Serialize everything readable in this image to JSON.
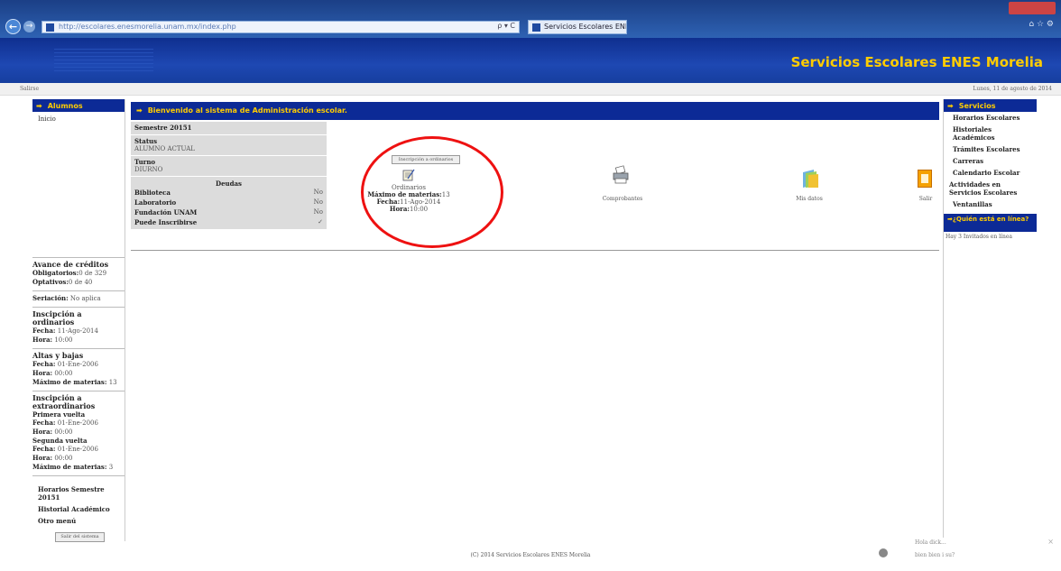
{
  "browser": {
    "url": "http://escolares.enesmorelia.unam.mx/index.php",
    "address_tools": "ρ ▾ C",
    "tab_title": "Servicios Escolares ENES M... ×",
    "back": "←",
    "forward": "→",
    "window_icons": "⌂ ☆ ⚙"
  },
  "header": {
    "title": "Servicios Escolares ENES Morelia"
  },
  "topbar": {
    "home": "Salirse",
    "date": "Lunes, 11 de agosto de 2014"
  },
  "left": {
    "heading": "Alumnos",
    "inicio": "Inicio",
    "avance": {
      "title": "Avance de créditos",
      "obligatorios_label": "Obligatorios:",
      "obligatorios_value": "0 de 329",
      "optativos_label": "Optativos:",
      "optativos_value": "0 de 40"
    },
    "seriacion": {
      "label": "Seriación:",
      "value": "No aplica"
    },
    "insc_ord": {
      "title": "Inscipción a ordinarios",
      "fecha_label": "Fecha:",
      "fecha_value": "11-Ago-2014",
      "hora_label": "Hora:",
      "hora_value": "10:00"
    },
    "altas": {
      "title": "Altas y bajas",
      "fecha_label": "Fecha:",
      "fecha_value": "01-Ene-2006",
      "hora_label": "Hora:",
      "hora_value": "00:00",
      "max_label": "Máximo de materias:",
      "max_value": "13"
    },
    "extra": {
      "title": "Inscipción a extraordinarios",
      "primera": "Primera vuelta",
      "fecha1_label": "Fecha:",
      "fecha1_value": "01-Ene-2006",
      "hora1_label": "Hora:",
      "hora1_value": "00:00",
      "segunda": "Segunda vuelta",
      "fecha2_label": "Fecha:",
      "fecha2_value": "01-Ene-2006",
      "hora2_label": "Hora:",
      "hora2_value": "00:00",
      "max_label": "Máximo de materias:",
      "max_value": "3"
    },
    "horarios": "Horarios Semestre 20151",
    "historial": "Historial Académico",
    "otro": "Otro menú",
    "salir_button": "Salir del sistema"
  },
  "center": {
    "heading": "Bienvenido al sistema de Administración escolar.",
    "semestre": "Semestre 20151",
    "status_label": "Status",
    "status_value": "ALUMNO ACTUAL",
    "turno_label": "Turno",
    "turno_value": "DIURNO",
    "deudas_title": "Deudas",
    "deudas": [
      {
        "label": "Biblioteca",
        "value": "No"
      },
      {
        "label": "Laboratorio",
        "value": "No"
      },
      {
        "label": "Fundación UNAM",
        "value": "No"
      },
      {
        "label": "Puede Inscribirse",
        "value": "✓"
      }
    ],
    "insc_button": "Inscripción a ordinarios",
    "ord_title": "Ordinarios",
    "ord_max_label": "Máximo de materias:",
    "ord_max_value": "13",
    "ord_fecha_label": "Fecha:",
    "ord_fecha_value": "11-Ago-2014",
    "ord_hora_label": "Hora:",
    "ord_hora_value": "10:00",
    "comprobantes": "Comprobantes",
    "mis_datos": "Mis datos",
    "salir": "Salir"
  },
  "right": {
    "heading": "Servicios",
    "links": [
      "Horarios Escolares",
      "Historiales Académicos",
      "Trámites Escolares",
      "Carreras",
      "Calendario Escolar",
      "Actividades en Servicios Escolares",
      "Ventanillas"
    ],
    "quien": "¿Quién está en línea?",
    "guests": "Hay 3 Invitados en línea"
  },
  "footer": {
    "text": "(C) 2014 Servicios Escolares ENES Morelia"
  },
  "chat": {
    "line1": "Hola dick...",
    "line2": "bien bien i su?",
    "close": "×"
  },
  "colors": {
    "header_blue": "#1e48b3",
    "title_yellow": "#ffcc00",
    "box_blue": "#0c2a96",
    "highlight_red": "#ee1111"
  }
}
